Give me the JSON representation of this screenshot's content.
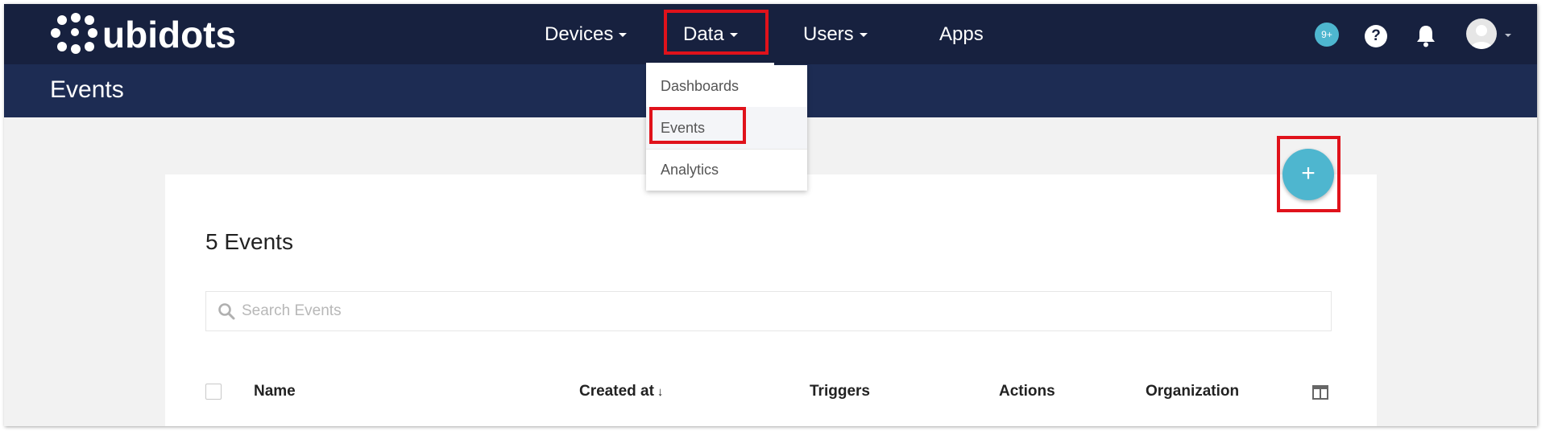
{
  "brand": {
    "logo_text": "ubidots"
  },
  "nav": {
    "items": [
      {
        "label": "Devices",
        "has_caret": true
      },
      {
        "label": "Data",
        "has_caret": true
      },
      {
        "label": "Users",
        "has_caret": true
      },
      {
        "label": "Apps",
        "has_caret": false
      }
    ],
    "notification_badge": "9+",
    "help_label": "?"
  },
  "page": {
    "title": "Events"
  },
  "data_menu": {
    "items": [
      {
        "label": "Dashboards"
      },
      {
        "label": "Events"
      },
      {
        "label": "Analytics"
      }
    ]
  },
  "events_panel": {
    "count_title": "5 Events",
    "search_placeholder": "Search Events",
    "search_value": "",
    "columns": [
      "Name",
      "Created at",
      "Triggers",
      "Actions",
      "Organization"
    ],
    "sort_indicator": "↓"
  },
  "fab": {
    "label": "+"
  },
  "colors": {
    "nav_bg": "#17213f",
    "subbar_bg": "#1d2c53",
    "accent": "#4eb6cf",
    "highlight": "#e0121b"
  },
  "icons": [
    "search-icon",
    "bell-icon",
    "help-icon",
    "avatar-icon",
    "columns-icon",
    "caret-down-icon"
  ]
}
